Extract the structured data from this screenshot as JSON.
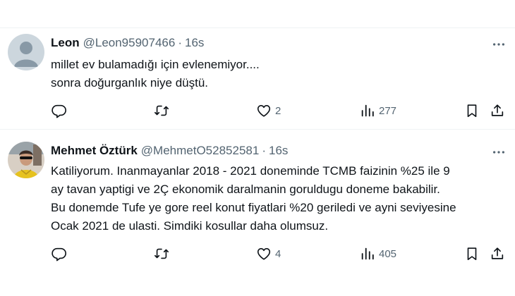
{
  "tweets": [
    {
      "name": "Leon",
      "handle": "@Leon95907466",
      "separator": "·",
      "time": "16s",
      "lines": [
        "millet ev bulamadığı için evlenemiyor....",
        "sonra doğurganlık niye düştü."
      ],
      "likes": "2",
      "views": "277",
      "avatar": "default-avatar"
    },
    {
      "name": "Mehmet Öztürk",
      "handle": "@MehmetO52852581",
      "separator": "·",
      "time": "16s",
      "lines": [
        "Katiliyorum. Inanmayanlar 2018 - 2021 doneminde TCMB faizinin %25 ile 9",
        "ay tavan yaptigi ve 2Ç ekonomik daralmanin goruldugu doneme bakabilir.",
        "Bu donemde Tufe ye gore reel konut fiyatlari %20 geriledi ve ayni seviyesine",
        "Ocak 2021 de ulasti. Simdiki kosullar daha olumsuz."
      ],
      "likes": "4",
      "views": "405",
      "avatar": "photo-avatar"
    }
  ],
  "colors": {
    "text": "#0f1419",
    "muted": "#536471",
    "divider": "#eff3f4",
    "default_avatar_bg": "#ccd6dd"
  },
  "icons": [
    "more-icon",
    "reply-icon",
    "retweet-icon",
    "like-icon",
    "views-icon",
    "bookmark-icon",
    "share-icon"
  ]
}
